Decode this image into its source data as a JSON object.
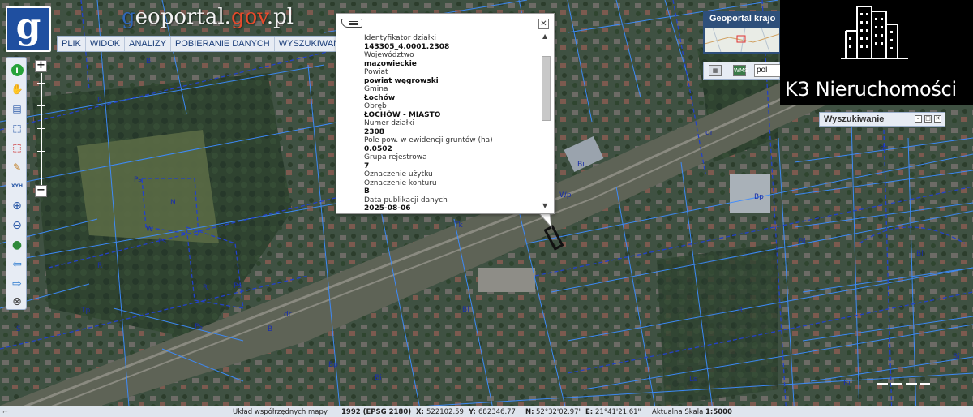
{
  "header": {
    "logo_letter": "g",
    "site_title_prefix": "",
    "site_title_g": "g",
    "site_title_mid": "eoportal.",
    "site_title_gov": "gov",
    "site_title_suffix": ".pl"
  },
  "menu": {
    "items": [
      {
        "label": "PLIK"
      },
      {
        "label": "WIDOK"
      },
      {
        "label": "ANALIZY"
      },
      {
        "label": "POBIERANIE DANYCH"
      },
      {
        "label": "WYSZUKIWANIA"
      }
    ]
  },
  "toolbar": {
    "icons": [
      {
        "name": "info-icon",
        "glyph": "i"
      },
      {
        "name": "hand-pan-icon",
        "glyph": "✋"
      },
      {
        "name": "layers-list-icon",
        "glyph": "▤"
      },
      {
        "name": "select-area-icon",
        "glyph": "⬚"
      },
      {
        "name": "select-red-icon",
        "glyph": "⬚"
      },
      {
        "name": "pencil-icon",
        "glyph": "✎"
      },
      {
        "name": "xyh-icon",
        "glyph": "XYH"
      },
      {
        "name": "zoom-in-icon",
        "glyph": "⊕"
      },
      {
        "name": "zoom-out-icon",
        "glyph": "⊖"
      },
      {
        "name": "globe-icon",
        "glyph": "●"
      },
      {
        "name": "arrow-left-icon",
        "glyph": "⇦"
      },
      {
        "name": "arrow-right-icon",
        "glyph": "⇨"
      },
      {
        "name": "compass-icon",
        "glyph": "⊗"
      }
    ],
    "zoom_plus": "+",
    "zoom_minus": "−"
  },
  "popup": {
    "close_glyph": "✕",
    "fields": [
      {
        "label": "Identyfikator działki",
        "value": "143305_4.0001.2308"
      },
      {
        "label": "Województwo",
        "value": "mazowieckie"
      },
      {
        "label": "Powiat",
        "value": "powiat węgrowski"
      },
      {
        "label": "Gmina",
        "value": "Łochów"
      },
      {
        "label": "Obręb",
        "value": "ŁOCHÓW - MIASTO"
      },
      {
        "label": "Numer działki",
        "value": "2308"
      },
      {
        "label": "Pole pow. w ewidencji gruntów (ha)",
        "value": "0.0502"
      },
      {
        "label": "Grupa rejestrowa",
        "value": "7"
      },
      {
        "label": "Oznaczenie użytku",
        "value": ""
      },
      {
        "label": "Oznaczenie konturu",
        "value": "B"
      },
      {
        "label": "Data publikacji danych",
        "value": "2025-08-06"
      }
    ]
  },
  "overview": {
    "title": "Geoportal krajo",
    "search_value": "pol",
    "btn1": "▦",
    "btn2": "WMS"
  },
  "brand": {
    "text": "K3 Nieruchomości"
  },
  "search_panel": {
    "title": "Wyszukiwanie",
    "min_glyph": "–",
    "max_glyph": "□",
    "close_glyph": "✕"
  },
  "status": {
    "system_label": "Układ współrzędnych mapy",
    "system_value": "1992 (EPSG 2180)",
    "x_label": "X:",
    "x_value": "522102.59",
    "y_label": "Y:",
    "y_value": "682346.77",
    "n_label": "N:",
    "n_value": "52°32'02.97\"",
    "e_label": "E:",
    "e_value": "21°41'21.61\"",
    "scale_label": "Aktualna Skala",
    "scale_value": "1:5000"
  },
  "map_labels": [
    "Bi",
    "R",
    "Ps",
    "N",
    "Tk",
    "dr",
    "B",
    "S",
    "Ls",
    "Bp",
    "Tp",
    "W",
    "Wp"
  ],
  "colors": {
    "parcel_line": "#3d8cff",
    "boundary_dashed": "#2342c8",
    "panel_bg": "#e7ecf4",
    "menu_text": "#1c3f7a",
    "logo_bg": "#1f4fa0"
  }
}
